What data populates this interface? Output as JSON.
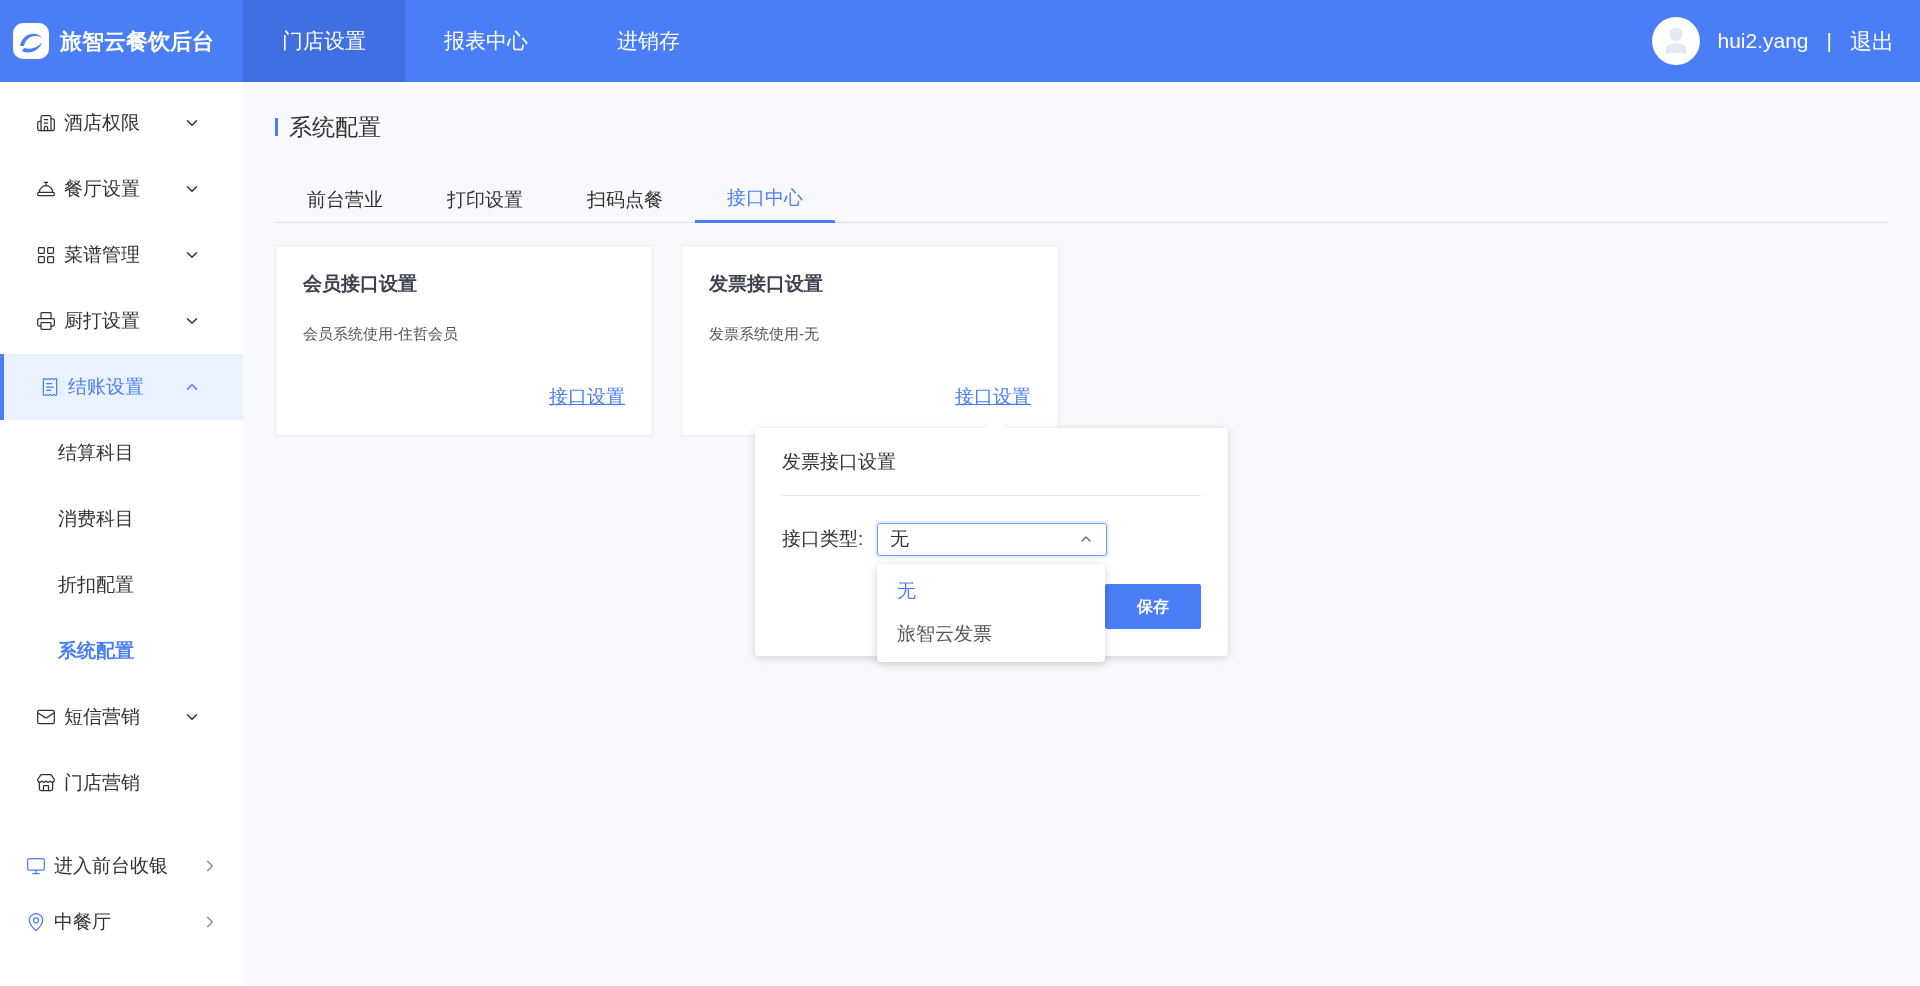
{
  "header": {
    "brand": "旅智云餐饮后台",
    "nav": [
      {
        "label": "门店设置",
        "selected": true
      },
      {
        "label": "报表中心",
        "selected": false
      },
      {
        "label": "进销存",
        "selected": false
      }
    ],
    "user": "hui2.yang",
    "separator": "|",
    "logout": "退出"
  },
  "sidebar": {
    "items": [
      {
        "kind": "menu",
        "label": "酒店权限",
        "expanded": false,
        "selected": false
      },
      {
        "kind": "menu",
        "label": "餐厅设置",
        "expanded": false,
        "selected": false
      },
      {
        "kind": "menu",
        "label": "菜谱管理",
        "expanded": false,
        "selected": false
      },
      {
        "kind": "menu",
        "label": "厨打设置",
        "expanded": false,
        "selected": false
      },
      {
        "kind": "menu",
        "label": "结账设置",
        "expanded": true,
        "selected": true,
        "children": [
          {
            "label": "结算科目",
            "selected": false
          },
          {
            "label": "消费科目",
            "selected": false
          },
          {
            "label": "折扣配置",
            "selected": false
          },
          {
            "label": "系统配置",
            "selected": true
          }
        ]
      },
      {
        "kind": "menu",
        "label": "短信营销",
        "expanded": false,
        "selected": false
      },
      {
        "kind": "plain",
        "label": "门店营销",
        "selected": false
      },
      {
        "kind": "link",
        "label": "进入前台收银"
      },
      {
        "kind": "link",
        "label": "中餐厅"
      }
    ]
  },
  "page": {
    "title": "系统配置",
    "tabs": [
      {
        "label": "前台营业",
        "selected": false
      },
      {
        "label": "打印设置",
        "selected": false
      },
      {
        "label": "扫码点餐",
        "selected": false
      },
      {
        "label": "接口中心",
        "selected": true
      }
    ],
    "cards": [
      {
        "title": "会员接口设置",
        "description": "会员系统使用-住哲会员",
        "link": "接口设置"
      },
      {
        "title": "发票接口设置",
        "description": "发票系统使用-无",
        "link": "接口设置"
      }
    ]
  },
  "popover": {
    "title": "发票接口设置",
    "field_label": "接口类型:",
    "value": "无",
    "expanded": true,
    "options": [
      {
        "label": "无",
        "selected": true
      },
      {
        "label": "旅智云发票",
        "selected": false
      }
    ],
    "save": "保存"
  }
}
